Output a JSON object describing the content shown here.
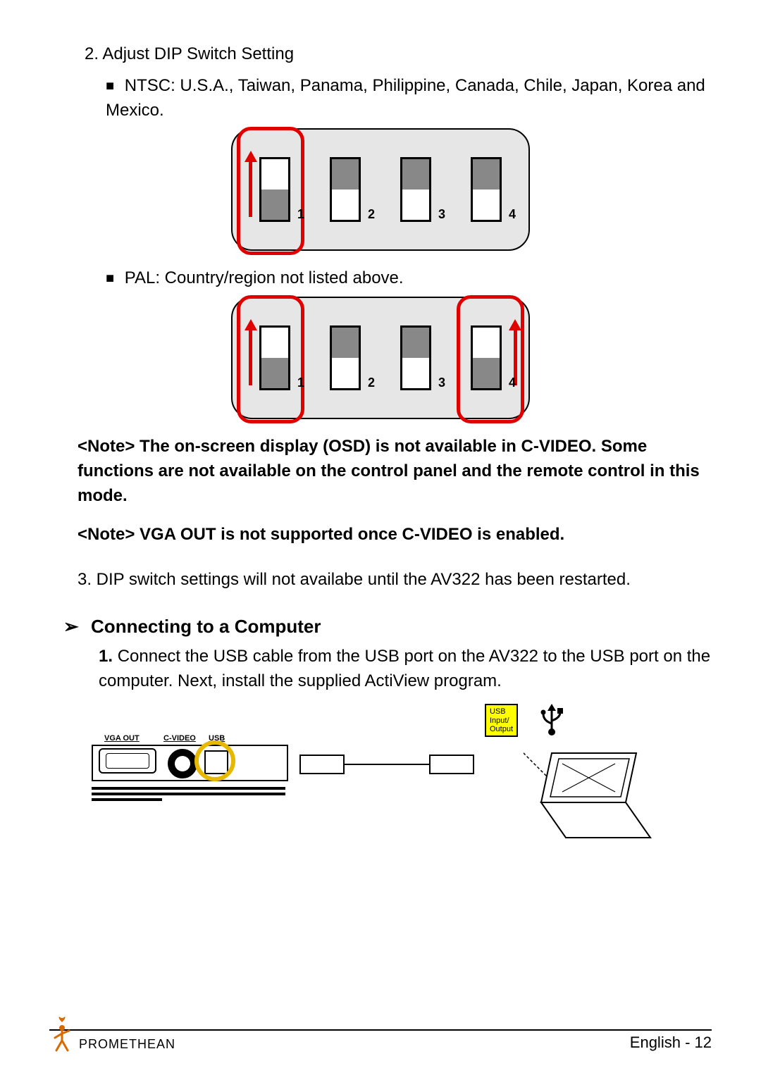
{
  "section": {
    "item2_title": "2. Adjust DIP Switch Setting",
    "bullet_ntsc": "NTSC: U.S.A., Taiwan, Panama, Philippine, Canada, Chile, Japan, Korea and Mexico.",
    "bullet_pal": "PAL: Country/region not listed above.",
    "note1": "<Note> The on-screen display (OSD) is not available in C-VIDEO. Some functions are not available on the control panel and the remote control in this mode.",
    "note2": "<Note> VGA OUT is not supported once C-VIDEO is enabled.",
    "item3": "3. DIP switch settings will not availabe until the AV322 has been restarted.",
    "connect_heading": "Connecting to a Computer",
    "step1_prefix": "1.",
    "step1_body": "Connect the USB cable from the USB port on the AV322 to the USB port on the computer. Next, install the supplied ActiView program."
  },
  "dip": {
    "labels": [
      "1",
      "2",
      "3",
      "4"
    ],
    "ntsc_positions": [
      "down",
      "up",
      "up",
      "up"
    ],
    "pal_positions": [
      "down",
      "up",
      "up",
      "down"
    ]
  },
  "ports": {
    "vga_label": "VGA OUT",
    "cvideo_label": "C-VIDEO",
    "usb_label": "USB",
    "usb_tag_line1": "USB",
    "usb_tag_line2": "Input/",
    "usb_tag_line3": "Output"
  },
  "footer": {
    "brand": "PROMETHEAN",
    "page_lang": "English",
    "page_sep": "-",
    "page_num": "12"
  }
}
